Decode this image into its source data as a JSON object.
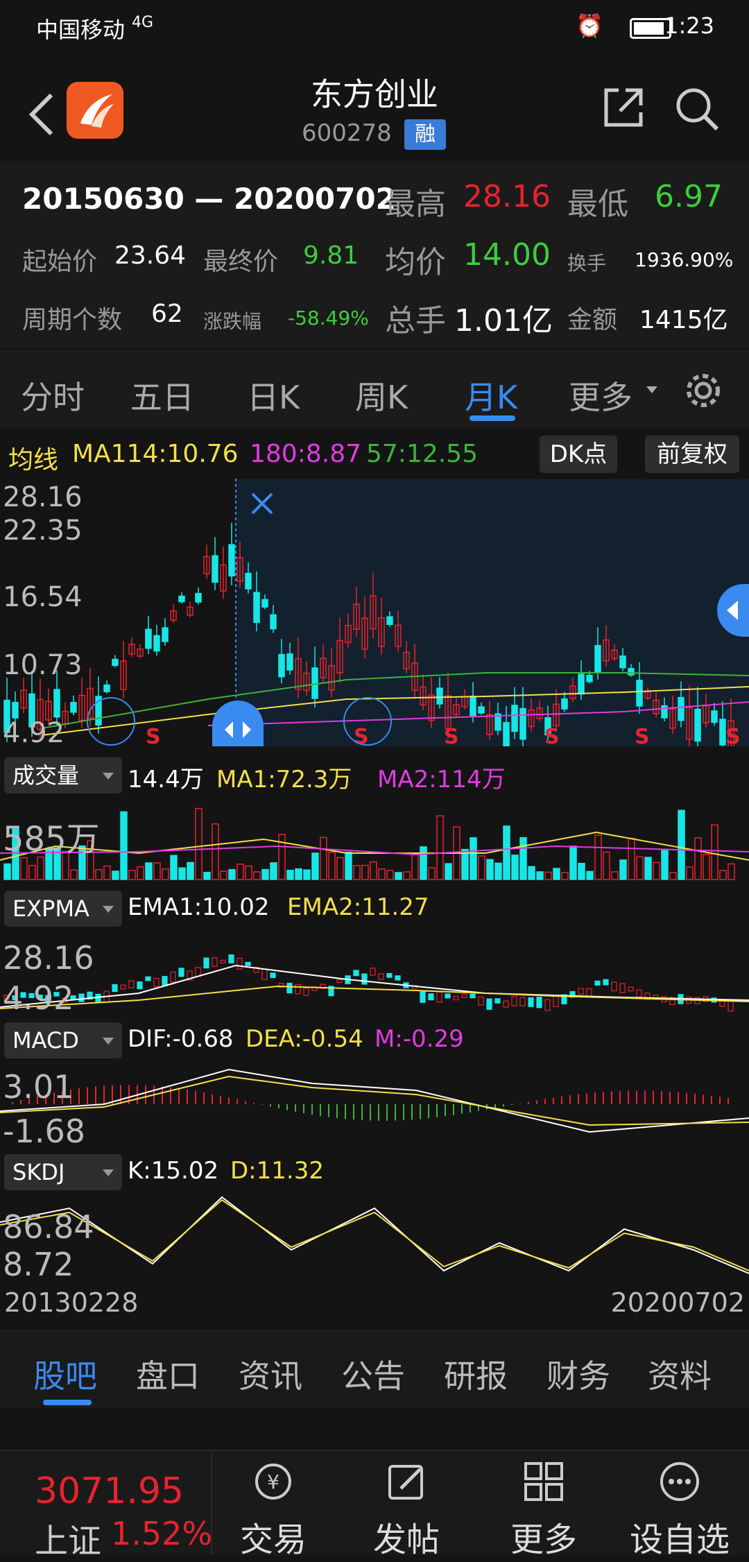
{
  "status_bar": {
    "carrier": "中国移动",
    "network": "4G",
    "time": "1:23"
  },
  "header": {
    "title": "东方创业",
    "code": "600278",
    "badge": "融"
  },
  "summary": {
    "range": "20150630 — 20200702",
    "high_label": "最高",
    "high": "28.16",
    "low_label": "最低",
    "low": "6.97",
    "open_label": "起始价",
    "open": "23.64",
    "close_label": "最终价",
    "close": "9.81",
    "avg_label": "均价",
    "avg": "14.00",
    "turnover_label": "换手",
    "turnover": "1936.90%",
    "periods_label": "周期个数",
    "periods": "62",
    "change_label": "涨跌幅",
    "change": "-58.49%",
    "volume_label": "总手",
    "volume": "1.01亿",
    "amount_label": "金额",
    "amount": "1415亿"
  },
  "tabs": [
    "分时",
    "五日",
    "日K",
    "周K",
    "月K",
    "更多"
  ],
  "active_tab": "月K",
  "ma": {
    "label": "均线",
    "ma1": "MA114:10.76",
    "ma2": "180:8.87",
    "ma3": "57:12.55",
    "dk_button": "DK点",
    "adjust_button": "前复权"
  },
  "kline_axis": {
    "top": "28.16",
    "mid1": "22.35",
    "mid2": "16.54",
    "mid3": "10.73",
    "bottom": "4.92"
  },
  "volume_panel": {
    "label": "成交量",
    "value": "14.4万",
    "ma1": "MA1:72.3万",
    "ma2": "MA2:114万",
    "axis": "585万"
  },
  "expma_panel": {
    "label": "EXPMA",
    "ema1": "EMA1:10.02",
    "ema2": "EMA2:11.27",
    "axis_top": "28.16",
    "axis_bottom": "4.92"
  },
  "macd_panel": {
    "label": "MACD",
    "dif": "DIF:-0.68",
    "dea": "DEA:-0.54",
    "m": "M:-0.29",
    "axis_top": "3.01",
    "axis_bottom": "-1.68"
  },
  "skdj_panel": {
    "label": "SKDJ",
    "k": "K:15.02",
    "d": "D:11.32",
    "axis_top": "86.84",
    "axis_bottom": "8.72"
  },
  "date_axis": {
    "start": "20130228",
    "end": "20200702"
  },
  "bottom_tabs": [
    "股吧",
    "盘口",
    "资讯",
    "公告",
    "研报",
    "财务",
    "资料"
  ],
  "index": {
    "name": "上证",
    "value": "3071.95",
    "change": "1.52%"
  },
  "toolbar": [
    "交易",
    "发帖",
    "更多",
    "设自选"
  ],
  "colors": {
    "up": "#e8232f",
    "down": "#18e6e6",
    "accent": "#3a8bf0",
    "yellow": "#f4e04a",
    "magenta": "#e23be2",
    "green": "#3cb43c"
  }
}
